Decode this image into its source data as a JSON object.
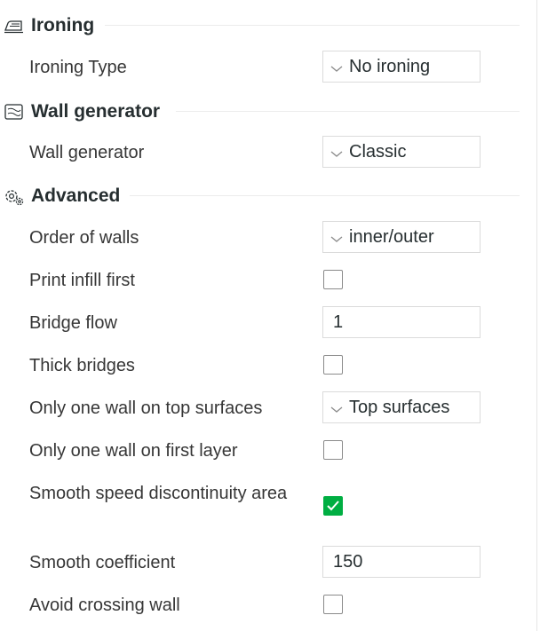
{
  "sections": {
    "ironing": {
      "title": "Ironing",
      "icon": "ironing-icon",
      "ironing_type": {
        "label": "Ironing Type",
        "value": "No ironing"
      }
    },
    "wall_generator": {
      "title": "Wall generator",
      "icon": "wall-generator-icon",
      "wall_generator": {
        "label": "Wall generator",
        "value": "Classic"
      }
    },
    "advanced": {
      "title": "Advanced",
      "icon": "gear-icon",
      "order_of_walls": {
        "label": "Order of walls",
        "value": "inner/outer"
      },
      "print_infill_first": {
        "label": "Print infill first",
        "checked": false
      },
      "bridge_flow": {
        "label": "Bridge flow",
        "value": "1"
      },
      "thick_bridges": {
        "label": "Thick bridges",
        "checked": false
      },
      "only_one_wall_top": {
        "label": "Only one wall on top surfaces",
        "value": "Top surfaces"
      },
      "only_one_wall_first": {
        "label": "Only one wall on first layer",
        "checked": false
      },
      "smooth_speed": {
        "label": "Smooth speed discontinuity area",
        "checked": true
      },
      "smooth_coefficient": {
        "label": "Smooth coefficient",
        "value": "150"
      },
      "avoid_crossing_wall": {
        "label": "Avoid crossing wall",
        "checked": false
      }
    }
  },
  "colors": {
    "accent_green": "#00ae42",
    "border": "#dbdbdb",
    "text": "#262e30"
  }
}
